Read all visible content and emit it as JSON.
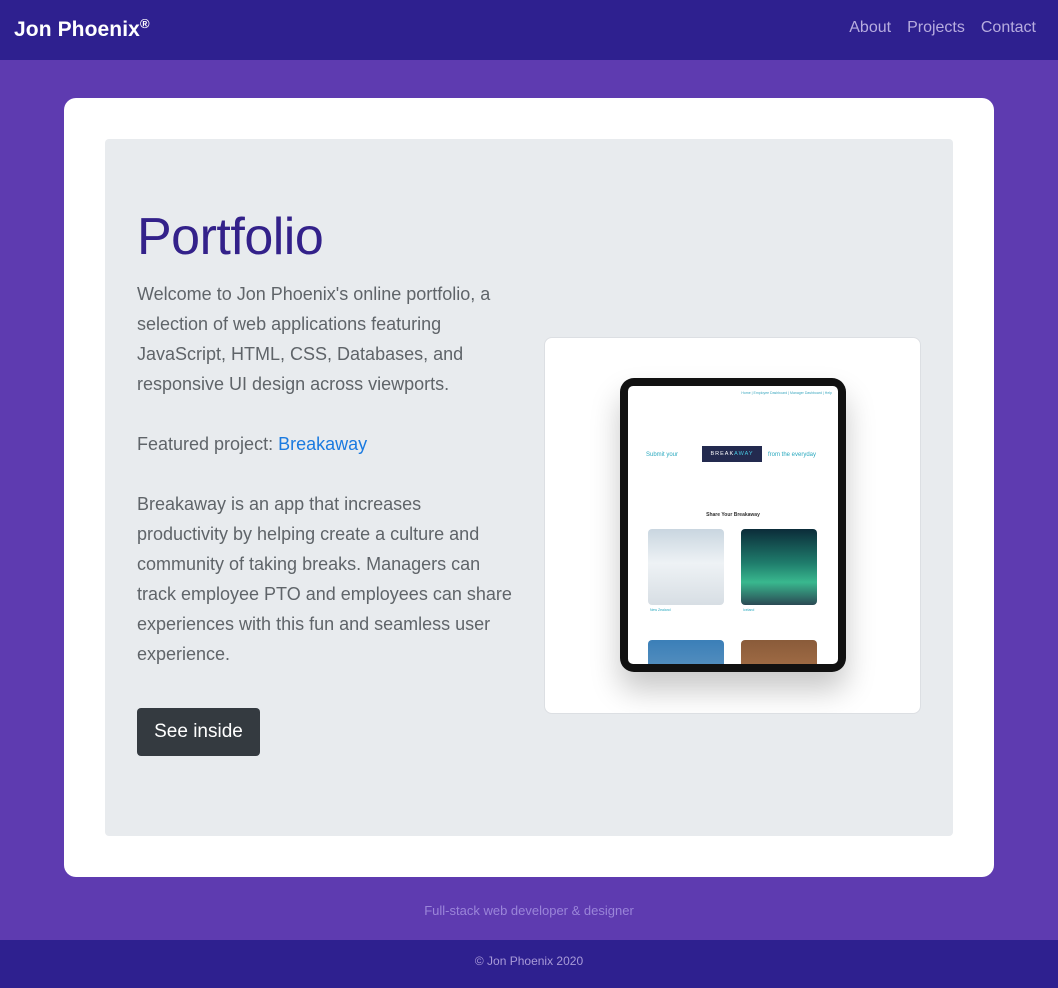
{
  "navbar": {
    "brand": "Jon Phoenix",
    "brand_mark": "®",
    "links": [
      "About",
      "Projects",
      "Contact"
    ]
  },
  "jumbotron": {
    "title": "Portfolio",
    "intro": "Welcome to Jon Phoenix's online portfolio, a selection of web applications featuring JavaScript, HTML, CSS, Databases, and responsive UI design across viewports.",
    "featured_prefix": "Featured project: ",
    "featured_link": "Breakaway",
    "description": "Breakaway is an app that increases productivity by helping create a culture and community of taking breaks. Managers can track employee PTO and employees can share experiences with this fun and seamless user experience.",
    "button_label": "See inside"
  },
  "preview": {
    "nav_text": "Home | Employee Dashboard | Manager Dashboard | Help",
    "submit_text": "Submit your",
    "logo_prefix": "BREAK",
    "logo_suffix": "AWAY",
    "from_text": "from the everyday",
    "share_heading": "Share Your Breakaway",
    "card_labels": [
      "New Zealand",
      "Iceland"
    ]
  },
  "tagline": "Full-stack web developer & designer",
  "footer": {
    "copyright": "© Jon Phoenix 2020"
  },
  "colors": {
    "page_bg": "#5e3bb0",
    "navbar_bg": "#2e208f",
    "title_color": "#33218a",
    "link_color": "#1a7ae0",
    "button_bg": "#343a40"
  }
}
